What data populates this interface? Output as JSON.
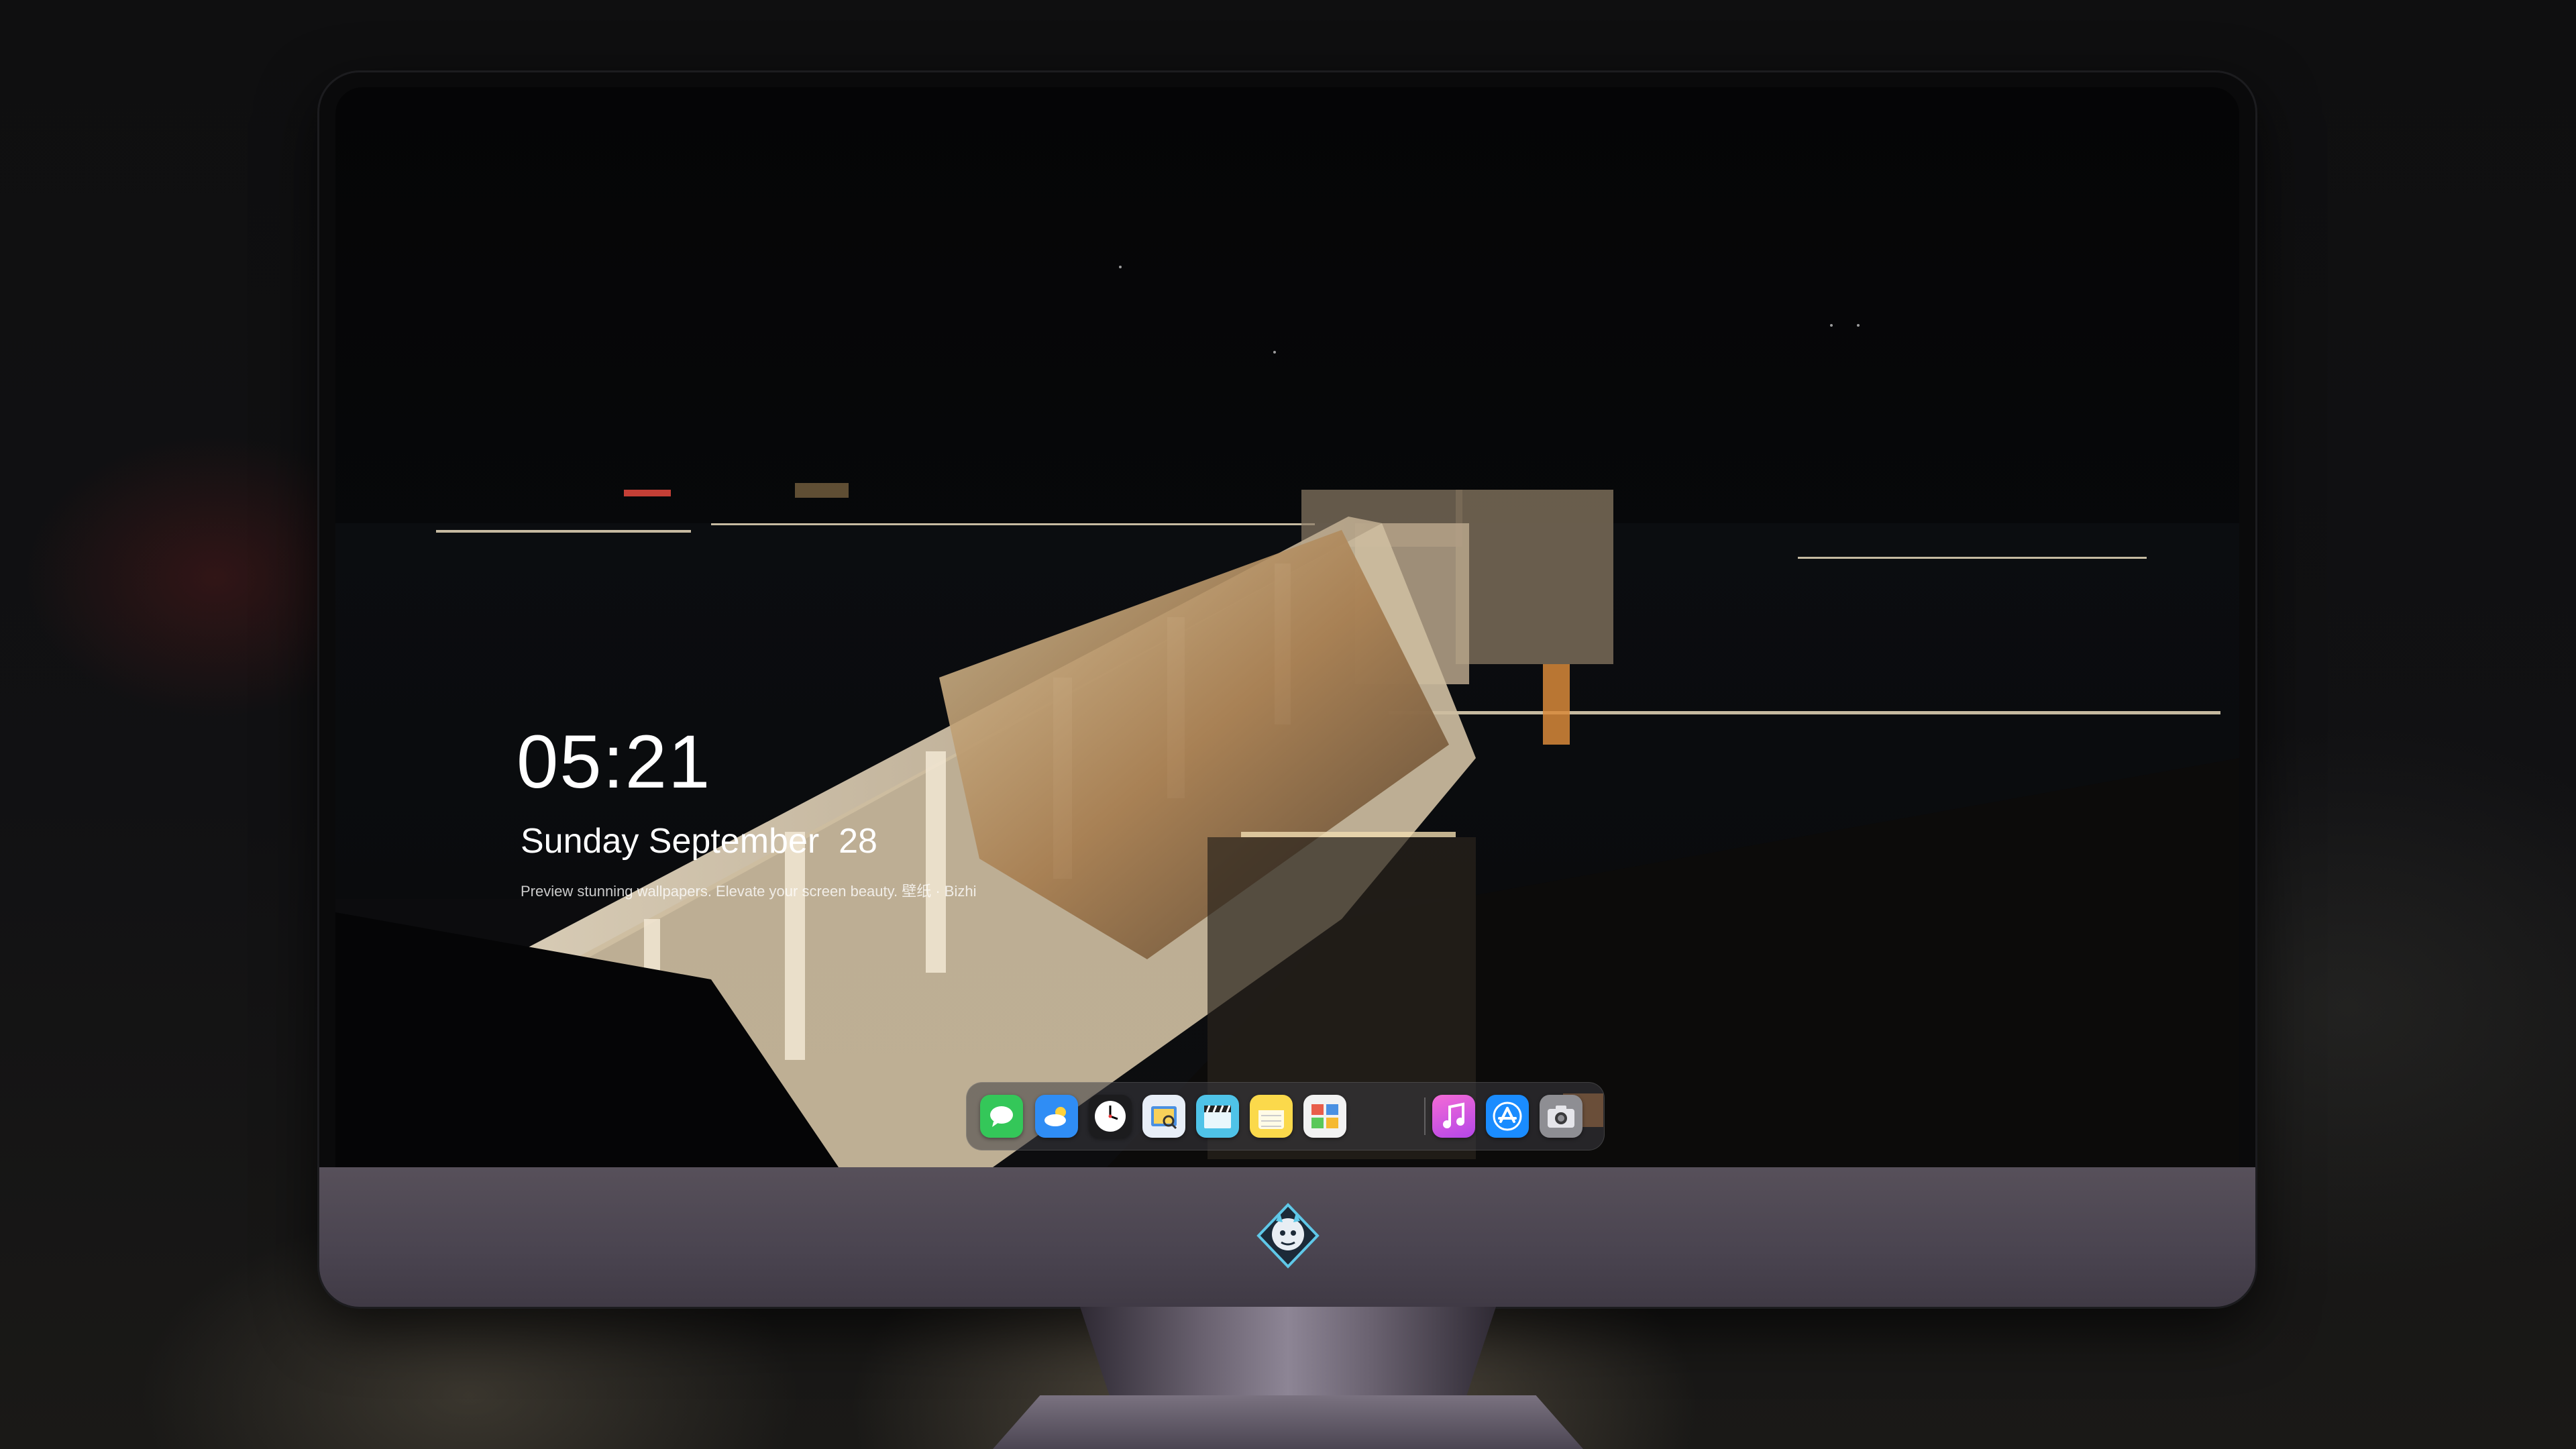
{
  "lockscreen": {
    "time": "05:21",
    "date": "Sunday September  28",
    "caption": "Preview stunning wallpapers. Elevate your screen beauty. 壁纸 · Bizhi"
  },
  "dock": {
    "apps": [
      {
        "name": "Messages",
        "icon": "messages-icon",
        "color": "#34c759"
      },
      {
        "name": "Weather",
        "icon": "weather-icon",
        "color": "#2f8df5"
      },
      {
        "name": "Clock",
        "icon": "clock-icon",
        "color": "#1c1c1e"
      },
      {
        "name": "Preview",
        "icon": "preview-icon",
        "color": "#e8eef7"
      },
      {
        "name": "Clips",
        "icon": "clapperboard-icon",
        "color": "#4fc3e8"
      },
      {
        "name": "Notes",
        "icon": "notes-icon",
        "color": "#fbd94b"
      },
      {
        "name": "Photo Booth",
        "icon": "photo-booth-icon",
        "color": "#f2f2f2"
      },
      {
        "name": "iTunes",
        "icon": "music-note-icon",
        "color": "#e04bd8"
      },
      {
        "name": "App Store",
        "icon": "app-store-icon",
        "color": "#1a8cff"
      },
      {
        "name": "Camera",
        "icon": "camera-icon",
        "color": "#8e8e93"
      }
    ]
  },
  "monitor": {
    "logo_icon": "dragon-mascot-icon"
  },
  "colors": {
    "dam_light": "#e9dcc2",
    "dam_warm": "#c98a4a",
    "chin": "#4f4856",
    "dock_bg": "#3c3c42"
  }
}
